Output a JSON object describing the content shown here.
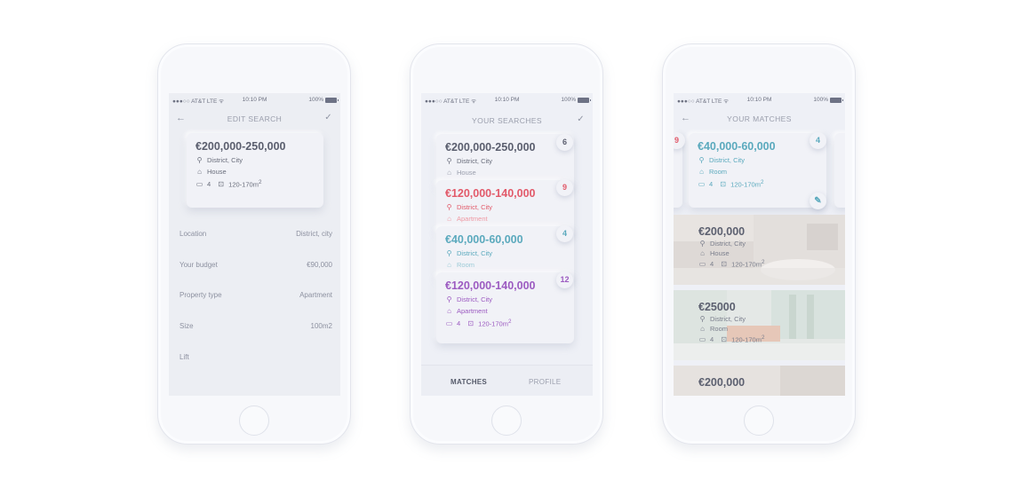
{
  "status": {
    "carrier": "●●●○○ AT&T LTE ᯤ",
    "time": "10:10 PM",
    "battery": "100%"
  },
  "colors": {
    "grey": "#5a5e6e",
    "red": "#e25a6a",
    "teal": "#5aa9bd",
    "purple": "#9c5bc1"
  },
  "edit": {
    "title": "EDIT SEARCH",
    "card": {
      "price": "€200,000-250,000",
      "location": "District, City",
      "type": "House",
      "beds": "4",
      "size": "120-170m",
      "size_sup": "2"
    },
    "rows": [
      {
        "label": "Location",
        "value": "District, city"
      },
      {
        "label": "Your budget",
        "value": "€90,000"
      },
      {
        "label": "Property type",
        "value": "Apartment"
      },
      {
        "label": "Size",
        "value": "100m2"
      },
      {
        "label": "Lift",
        "value": ""
      }
    ]
  },
  "searches": {
    "title": "YOUR SEARCHES",
    "cards": [
      {
        "price": "€200,000-250,000",
        "location": "District, City",
        "type": "House",
        "count": "6",
        "color": "#5a5e6e"
      },
      {
        "price": "€120,000-140,000",
        "location": "District, City",
        "type": "Apartment",
        "count": "9",
        "color": "#e25a6a"
      },
      {
        "price": "€40,000-60,000",
        "location": "District, City",
        "type": "Room",
        "count": "4",
        "color": "#5aa9bd"
      },
      {
        "price": "€120,000-140,000",
        "location": "District, City",
        "type": "Apartment",
        "count": "12",
        "color": "#9c5bc1",
        "beds": "4",
        "size": "120-170m",
        "size_sup": "2"
      }
    ],
    "tabs": {
      "matches": "MATCHES",
      "profile": "PROFILE"
    }
  },
  "matches": {
    "title": "YOUR MATCHES",
    "left_badge": "9",
    "card": {
      "price": "€40,000-60,000",
      "location": "District, City",
      "type": "Room",
      "beds": "4",
      "size": "120-170m",
      "size_sup": "2",
      "count": "4"
    },
    "listings": [
      {
        "price": "€200,000",
        "location": "District, City",
        "type": "House",
        "beds": "4",
        "size": "120-170m",
        "size_sup": "2"
      },
      {
        "price": "€25000",
        "location": "District, City",
        "type": "Room",
        "beds": "4",
        "size": "120-170m",
        "size_sup": "2"
      },
      {
        "price": "€200,000"
      }
    ]
  },
  "icons": {
    "back": "arrow-left-icon",
    "check": "check-icon",
    "pin": "location-pin-icon",
    "home": "home-icon",
    "bed": "bed-icon",
    "area": "area-icon",
    "edit": "pencil-icon"
  }
}
